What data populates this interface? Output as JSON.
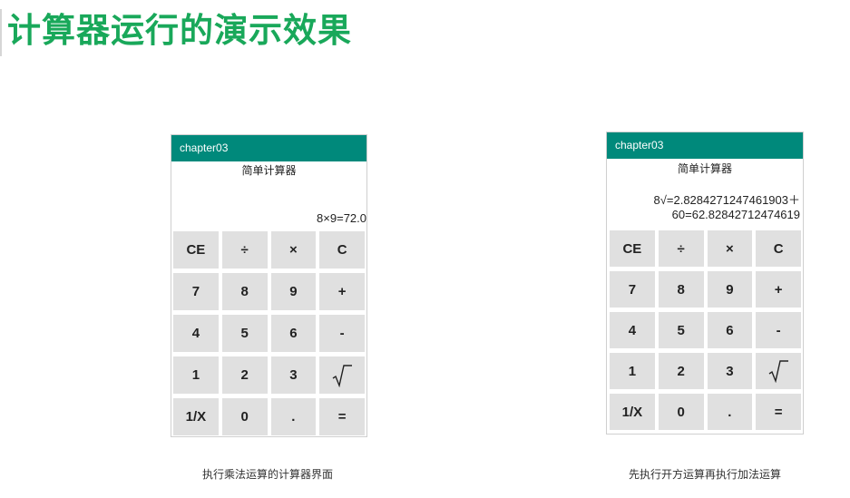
{
  "slide": {
    "title": "计算器运行的演示效果"
  },
  "screens": [
    {
      "app_title": "chapter03",
      "calc_title": "简单计算器",
      "display_lines": [
        "8×9=72.0"
      ],
      "caption": "执行乘法运算的计算器界面"
    },
    {
      "app_title": "chapter03",
      "calc_title": "简单计算器",
      "display_lines": [
        "8√=2.8284271247461903＋",
        "60=62.82842712474619"
      ],
      "caption": "先执行开方运算再执行加法运算"
    }
  ],
  "keys": [
    {
      "name": "clear-entry",
      "label": "CE"
    },
    {
      "name": "divide",
      "label": "÷"
    },
    {
      "name": "multiply",
      "label": "×"
    },
    {
      "name": "clear",
      "label": "C"
    },
    {
      "name": "seven",
      "label": "7"
    },
    {
      "name": "eight",
      "label": "8"
    },
    {
      "name": "nine",
      "label": "9"
    },
    {
      "name": "plus",
      "label": "+"
    },
    {
      "name": "four",
      "label": "4"
    },
    {
      "name": "five",
      "label": "5"
    },
    {
      "name": "six",
      "label": "6"
    },
    {
      "name": "minus",
      "label": "-"
    },
    {
      "name": "one",
      "label": "1"
    },
    {
      "name": "two",
      "label": "2"
    },
    {
      "name": "three",
      "label": "3"
    },
    {
      "name": "sqrt",
      "label": "",
      "icon": "square-root-icon"
    },
    {
      "name": "reciprocal",
      "label": "1/X"
    },
    {
      "name": "zero",
      "label": "0"
    },
    {
      "name": "decimal",
      "label": "."
    },
    {
      "name": "equals",
      "label": "="
    }
  ],
  "colors": {
    "title_green": "#19a85a",
    "appbar_teal": "#00897b",
    "key_gray": "#e0e0e0"
  }
}
